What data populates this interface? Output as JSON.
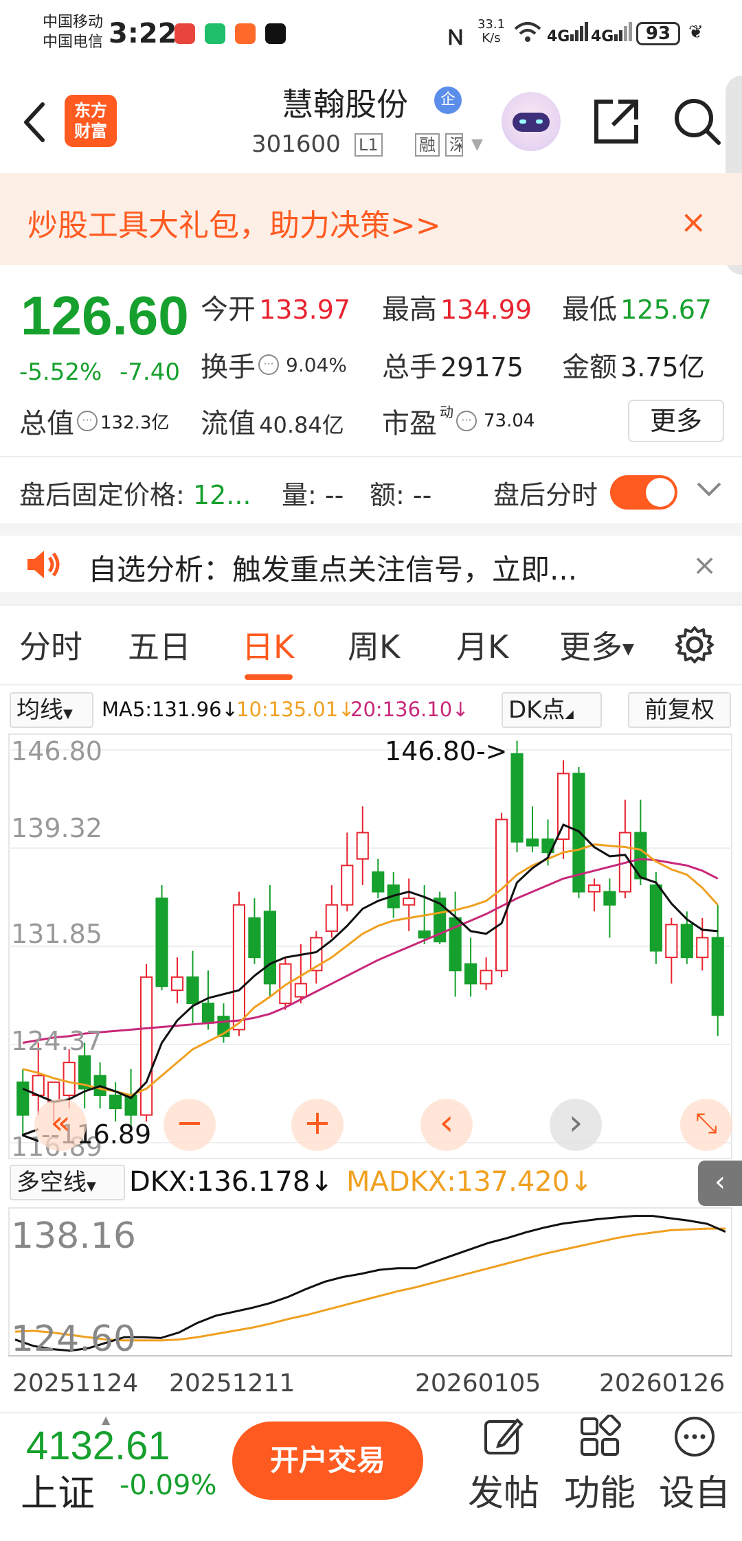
{
  "status_bar": {
    "carrier1": "中国移动",
    "carrier2": "中国电信",
    "time": "3:22",
    "net_speed": "33.1\nK/s",
    "signal1": "4G",
    "signal2": "4G",
    "battery": "93"
  },
  "header": {
    "logo_line1": "东方",
    "logo_line2": "财富",
    "stock_name": "慧翰股份",
    "badge": "企",
    "stock_code": "301600",
    "tag_l1": "L1",
    "tag_rong": "融",
    "tag_sh": "深"
  },
  "banner": {
    "text": "炒股工具大礼包，助力决策>>",
    "close": "×"
  },
  "quote": {
    "price": "126.60",
    "pct": "-5.52%",
    "chg": "-7.40",
    "open_label": "今开",
    "open": "133.97",
    "high_label": "最高",
    "high": "134.99",
    "low_label": "最低",
    "low": "125.67",
    "turnover_label": "换手",
    "turnover": "9.04%",
    "volume_label": "总手",
    "volume": "29175",
    "amount_label": "金额",
    "amount": "3.75亿",
    "mcap_label": "总值",
    "mcap": "132.3亿",
    "float_label": "流值",
    "float": "40.84亿",
    "pe_label": "市盈",
    "pe_sup": "动",
    "pe": "73.04",
    "more": "更多"
  },
  "after_hours": {
    "price_label": "盘后固定价格:",
    "price": "12...",
    "qty_label": "量:",
    "qty": "--",
    "amt_label": "额:",
    "amt": "--",
    "timeshare_label": "盘后分时",
    "toggle_on": true
  },
  "alert": {
    "text": "自选分析：触发重点关注信号，立即...",
    "close": "×"
  },
  "tabs": [
    "分时",
    "五日",
    "日K",
    "周K",
    "月K",
    "更多"
  ],
  "active_tab": "日K",
  "ma_row": {
    "selector": "均线",
    "ma5": "MA5:131.96↓",
    "ma10": "10:135.01↓",
    "ma20": "20:136.10↓",
    "dk": "DK点",
    "adjust": "前复权"
  },
  "colors": {
    "up": "#e8232f",
    "down": "#16a02d",
    "accent": "#ff5a1f",
    "ma5": "#111111",
    "ma10": "#f0a020",
    "ma20": "#c8287a"
  },
  "kline": {
    "y_labels": [
      "146.80",
      "139.32",
      "131.85",
      "124.37",
      "116.89"
    ],
    "max_annotation": "146.80->",
    "min_annotation": "<--116.89",
    "ymin": 116.89,
    "ymax": 146.8,
    "candles": [
      [
        121.5,
        122.5,
        117.5,
        119.0
      ],
      [
        120.5,
        124.5,
        119.0,
        122.0
      ],
      [
        120.0,
        121.5,
        118.5,
        121.5
      ],
      [
        120.5,
        124.0,
        119.5,
        123.0
      ],
      [
        123.5,
        124.5,
        119.5,
        121.0
      ],
      [
        122.0,
        123.0,
        119.5,
        120.5
      ],
      [
        120.5,
        121.5,
        118.5,
        119.5
      ],
      [
        120.5,
        122.5,
        118.0,
        119.0
      ],
      [
        119.0,
        130.5,
        118.5,
        129.5
      ],
      [
        135.5,
        136.5,
        128.5,
        128.8
      ],
      [
        128.5,
        131.0,
        127.5,
        129.5
      ],
      [
        129.5,
        131.5,
        126.0,
        127.5
      ],
      [
        127.5,
        130.0,
        125.5,
        126.0
      ],
      [
        126.5,
        127.5,
        124.5,
        125.0
      ],
      [
        125.5,
        136.0,
        125.0,
        135.0
      ],
      [
        134.0,
        135.5,
        130.5,
        131.0
      ],
      [
        134.5,
        136.5,
        128.0,
        129.0
      ],
      [
        127.5,
        131.0,
        127.0,
        130.5
      ],
      [
        128.0,
        132.0,
        127.5,
        129.0
      ],
      [
        130.0,
        133.0,
        129.0,
        132.5
      ],
      [
        133.0,
        136.5,
        132.5,
        135.0
      ],
      [
        135.0,
        140.5,
        134.5,
        138.0
      ],
      [
        138.5,
        142.5,
        136.5,
        140.5
      ],
      [
        137.5,
        138.5,
        135.5,
        136.0
      ],
      [
        136.5,
        137.5,
        134.0,
        134.8
      ],
      [
        135.0,
        137.0,
        133.0,
        135.5
      ],
      [
        133.0,
        136.5,
        132.0,
        132.5
      ],
      [
        135.5,
        136.0,
        132.0,
        132.2
      ],
      [
        134.0,
        136.0,
        128.0,
        130.0
      ],
      [
        130.5,
        132.5,
        128.0,
        129.0
      ],
      [
        129.0,
        131.0,
        128.5,
        130.0
      ],
      [
        130.0,
        142.0,
        129.5,
        141.5
      ],
      [
        146.5,
        147.5,
        139.0,
        139.8
      ],
      [
        140.0,
        142.5,
        139.0,
        139.5
      ],
      [
        140.0,
        141.5,
        138.0,
        139.0
      ],
      [
        140.0,
        146.0,
        138.5,
        145.0
      ],
      [
        145.0,
        145.5,
        135.5,
        136.0
      ],
      [
        136.0,
        137.0,
        134.5,
        136.5
      ],
      [
        136.0,
        137.0,
        132.5,
        135.0
      ],
      [
        136.0,
        143.0,
        135.5,
        140.5
      ],
      [
        140.5,
        143.0,
        136.5,
        137.0
      ],
      [
        136.5,
        137.5,
        130.5,
        131.5
      ],
      [
        131.0,
        134.0,
        129.0,
        133.5
      ],
      [
        133.5,
        134.5,
        130.5,
        131.0
      ],
      [
        131.0,
        134.0,
        130.0,
        132.5
      ],
      [
        132.5,
        135.0,
        125.0,
        126.6
      ]
    ],
    "ma5": [
      121.0,
      120.5,
      120.0,
      120.2,
      120.8,
      121.2,
      120.8,
      120.3,
      121.5,
      124.5,
      126.2,
      127.3,
      127.9,
      128.2,
      128.5,
      129.6,
      130.5,
      131.0,
      131.2,
      131.4,
      132.3,
      133.4,
      134.7,
      135.3,
      135.7,
      136.0,
      135.6,
      135.1,
      134.1,
      133.0,
      132.8,
      133.6,
      136.7,
      137.8,
      138.6,
      141.1,
      140.6,
      139.4,
      138.7,
      138.8,
      137.1,
      136.7,
      135.1,
      133.9,
      133.1,
      133.0
    ],
    "ma10": [
      122.5,
      122.2,
      121.8,
      121.5,
      121.3,
      121.0,
      120.8,
      120.5,
      121.0,
      122.0,
      123.0,
      124.0,
      124.6,
      125.2,
      126.0,
      127.2,
      128.0,
      128.9,
      129.6,
      130.3,
      131.0,
      131.9,
      132.8,
      133.4,
      133.8,
      134.0,
      134.2,
      134.4,
      134.6,
      134.9,
      135.3,
      136.2,
      137.3,
      138.0,
      138.5,
      139.0,
      139.2,
      139.6,
      139.5,
      139.4,
      139.2,
      138.3,
      137.7,
      137.3,
      136.3,
      135.0
    ],
    "ma20": [
      124.5,
      124.7,
      124.9,
      125.0,
      125.2,
      125.3,
      125.4,
      125.5,
      125.6,
      125.7,
      125.8,
      125.9,
      126.0,
      126.1,
      126.2,
      126.4,
      126.7,
      127.2,
      127.8,
      128.4,
      129.0,
      129.6,
      130.2,
      130.8,
      131.3,
      131.8,
      132.3,
      132.8,
      133.3,
      133.8,
      134.3,
      134.9,
      135.5,
      136.0,
      136.5,
      137.0,
      137.3,
      137.6,
      137.9,
      138.2,
      138.5,
      138.4,
      138.2,
      138.0,
      137.6,
      137.0
    ],
    "nav_buttons": [
      "«",
      "−",
      "+",
      "‹",
      "›",
      "⤡"
    ]
  },
  "indicator": {
    "selector": "多空线",
    "dkx": "DKX:136.178↓",
    "madkx": "MADKX:137.420↓",
    "y_labels": [
      "138.16",
      "124.60"
    ],
    "ymin": 122.5,
    "ymax": 140.0,
    "dkx_series": [
      124.0,
      123.2,
      122.8,
      122.6,
      122.9,
      123.6,
      124.3,
      124.3,
      124.2,
      124.9,
      126.1,
      127.0,
      127.5,
      128.0,
      128.6,
      129.4,
      130.4,
      131.3,
      131.9,
      132.3,
      132.8,
      133.0,
      133.0,
      133.8,
      134.6,
      135.4,
      136.2,
      136.8,
      137.5,
      138.1,
      138.6,
      138.9,
      139.2,
      139.4,
      139.6,
      139.6,
      139.3,
      139.0,
      138.6,
      137.6
    ],
    "madkx_series": [
      125.0,
      125.1,
      124.9,
      124.6,
      124.3,
      124.0,
      123.9,
      123.9,
      123.9,
      124.0,
      124.3,
      124.7,
      125.1,
      125.5,
      126.0,
      126.6,
      127.1,
      127.7,
      128.3,
      128.9,
      129.5,
      130.1,
      130.6,
      131.2,
      131.8,
      132.4,
      133.0,
      133.6,
      134.2,
      134.8,
      135.3,
      135.8,
      136.3,
      136.8,
      137.2,
      137.5,
      137.8,
      137.9,
      138.0,
      138.0
    ],
    "dates": [
      "20251124",
      "20251211",
      "20260105",
      "20260126"
    ]
  },
  "bottom": {
    "index_value": "4132.61",
    "index_name": "上证",
    "index_chg": "-0.09%",
    "trade": "开户交易",
    "post": "发帖",
    "func": "功能",
    "custom": "设自"
  }
}
